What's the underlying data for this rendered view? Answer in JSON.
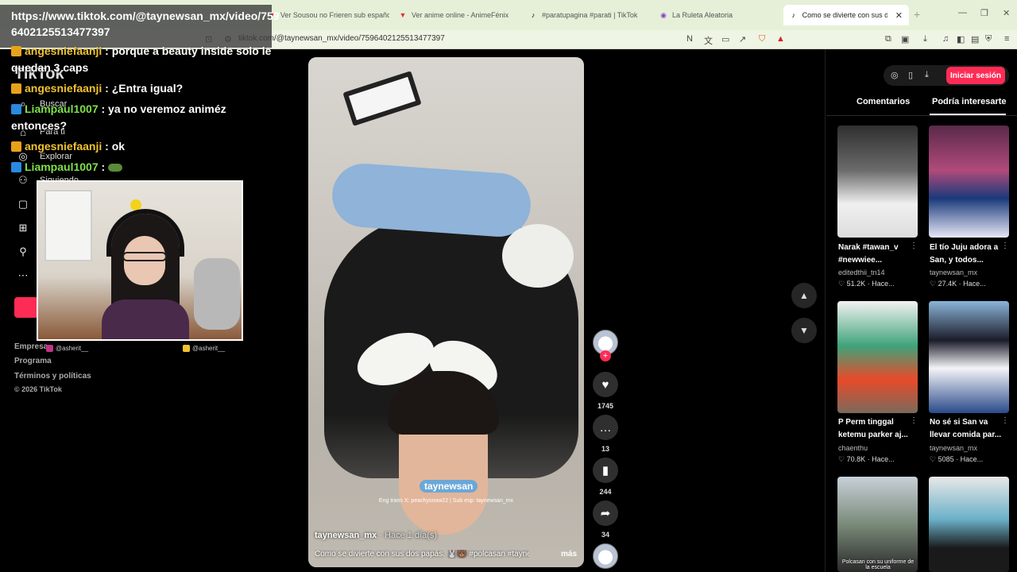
{
  "browser": {
    "tabs": [
      {
        "title": "Ver Sousou no Frieren sub español"
      },
      {
        "title": "Ver anime online - AnimeFénix"
      },
      {
        "title": "#paratupagina #parati | TikTok"
      },
      {
        "title": "La Ruleta Aleatoria"
      },
      {
        "title": "Como se divierte con sus dos p..."
      }
    ],
    "url": "tiktok.com/@taynewsan_mx/video/7596402125513477397"
  },
  "overlay": {
    "url_line1": "https://www.tiktok.com/@taynewsan_mx/video/759",
    "url_line2": "6402125513477397"
  },
  "chat": [
    {
      "user": "angesniefaanji",
      "msg": " : porque a beauty inside solo le quedan 3 caps",
      "color": "yellow",
      "badge": "crown"
    },
    {
      "user": "angesniefaanji",
      "msg": " : ¿Entra igual?",
      "color": "yellow",
      "badge": "crown"
    },
    {
      "user": "Liampaul1007",
      "msg": " : ya no veremoz animéz entonces?",
      "color": "green",
      "badge": "prime"
    },
    {
      "user": "angesniefaanji",
      "msg": " : ok",
      "color": "yellow",
      "badge": "crown"
    },
    {
      "user": "Liampaul1007",
      "msg": " : ",
      "color": "green",
      "badge": "prime"
    }
  ],
  "leftnav": {
    "logo": "TikTok",
    "items": [
      {
        "label": "Buscar",
        "icon": "search-icon"
      },
      {
        "label": "Para ti",
        "icon": "home-icon"
      },
      {
        "label": "Explorar",
        "icon": "compass-icon"
      },
      {
        "label": "Siguiendo",
        "icon": "following-icon"
      }
    ],
    "footer": [
      "Empresa",
      "Programa",
      "Términos y políticas",
      "© 2026 TikTok"
    ]
  },
  "socials": {
    "instagram": "@asherit__",
    "twitter": "@asherit__"
  },
  "video": {
    "author": "taynewsan_mx",
    "time": " · Hace 1 día(s)",
    "caption": "Como se divierte con sus dos papás. 🐰🐻 #polcasan #taynew ...",
    "more": "más",
    "sticker": "taynewsan",
    "subtitle": "Eng trans X: peachysnow22 | Sub esp: taynewsan_mx"
  },
  "actions": {
    "likes": "1745",
    "comments": "13",
    "saves": "244",
    "shares": "34"
  },
  "rightpanel": {
    "signin": "Iniciar sesión",
    "tabs": [
      "Comentarios",
      "Podría interesarte"
    ],
    "videos": [
      {
        "title": "Narak #tawan_v #newwiee...",
        "author": "editedthii_tn14",
        "views": "51.2K",
        "time": "Hace...",
        "caption": ""
      },
      {
        "title": "El tío Juju adora a San, y todos...",
        "author": "taynewsan_mx",
        "views": "27.4K",
        "time": "Hace...",
        "caption": ""
      },
      {
        "title": "P Perm tinggal ketemu parker aj...",
        "author": "chaenthu",
        "views": "70.8K",
        "time": "Hace...",
        "caption": ""
      },
      {
        "title": "No sé si San va llevar comida par...",
        "author": "taynewsan_mx",
        "views": "5085",
        "time": "Hace...",
        "caption": ""
      },
      {
        "title": "",
        "author": "",
        "views": "",
        "time": "",
        "caption": "Polcasan con su uniforme de la escuela"
      },
      {
        "title": "",
        "author": "",
        "views": "",
        "time": "",
        "caption": ""
      }
    ]
  }
}
